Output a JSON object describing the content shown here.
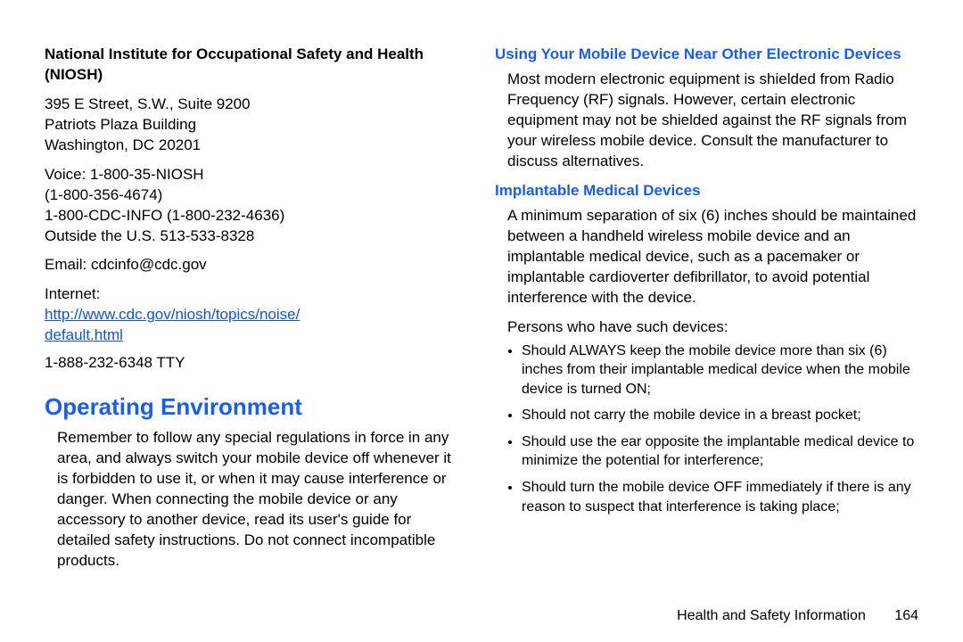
{
  "left": {
    "niosh_title": "National Institute for Occupational Safety and Health (NIOSH)",
    "addr1": "395 E Street, S.W., Suite 9200",
    "addr2": "Patriots Plaza Building",
    "addr3": "Washington, DC 20201",
    "voice1": "Voice: 1-800-35-NIOSH",
    "voice2": "(1-800-356-4674)",
    "voice3": "1-800-CDC-INFO (1-800-232-4636)",
    "voice4": "Outside the U.S. 513-533-8328",
    "email_label": "Email: cdcinfo@cdc.gov",
    "internet_label": "Internet:",
    "url_line1": "http://www.cdc.gov/niosh/topics/noise/",
    "url_line2": "default.html",
    "tty": "1-888-232-6348 TTY",
    "h1": "Operating Environment",
    "oe_body": "Remember to follow any special regulations in force in any area, and always switch your mobile device off whenever it is forbidden to use it, or when it may cause interference or danger. When connecting the mobile device or any accessory to another device, read its user's guide for detailed safety instructions. Do not connect incompatible products."
  },
  "right": {
    "h2a": "Using Your Mobile Device Near Other Electronic Devices",
    "body_a": "Most modern electronic equipment is shielded from Radio Frequency (RF) signals. However, certain electronic equipment may not be shielded against the RF signals from your wireless mobile device. Consult the manufacturer to discuss alternatives.",
    "h2b": "Implantable Medical Devices",
    "body_b": "A minimum separation of six (6) inches should be maintained between a handheld wireless mobile device and an implantable medical device, such as a pacemaker or implantable cardioverter defibrillator, to avoid potential interference with the device.",
    "persons_line": "Persons who have such devices:",
    "bullets": [
      "Should ALWAYS keep the mobile device more than six (6) inches from their implantable medical device when the mobile device is turned ON;",
      "Should not carry the mobile device in a breast pocket;",
      "Should use the ear opposite the implantable medical device to minimize the potential for interference;",
      "Should turn the mobile device OFF immediately if there is any reason to suspect that interference is taking place;"
    ]
  },
  "footer": {
    "section": "Health and Safety Information",
    "page": "164"
  }
}
